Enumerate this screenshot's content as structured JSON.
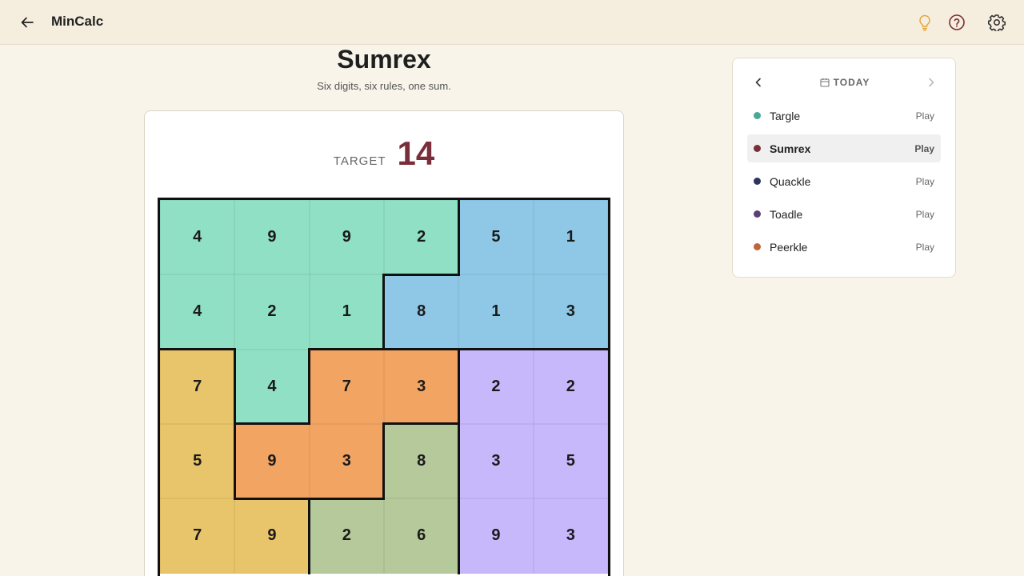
{
  "app": {
    "title": "MinCalc"
  },
  "header": {
    "back_icon": "arrow-left-icon",
    "hint_icon": "lightbulb-icon",
    "help_icon": "question-circle-icon",
    "settings_icon": "gear-icon"
  },
  "game": {
    "title": "Sumrex",
    "subtitle": "Six digits, six rules, one sum.",
    "target_label": "TARGET",
    "target_value": "14"
  },
  "colors": {
    "accent": "#7a2e3a",
    "region_teal": "#8fe0c4",
    "region_blue": "#8fc8e6",
    "region_yellow": "#e8c46a",
    "region_orange": "#f2a462",
    "region_olive": "#b5c99a",
    "region_purple": "#c7b8fb"
  },
  "grid": {
    "rows": [
      [
        {
          "v": "4",
          "r": "teal"
        },
        {
          "v": "9",
          "r": "teal"
        },
        {
          "v": "9",
          "r": "teal"
        },
        {
          "v": "2",
          "r": "teal"
        },
        {
          "v": "5",
          "r": "blue"
        },
        {
          "v": "1",
          "r": "blue"
        }
      ],
      [
        {
          "v": "4",
          "r": "teal"
        },
        {
          "v": "2",
          "r": "teal"
        },
        {
          "v": "1",
          "r": "teal"
        },
        {
          "v": "8",
          "r": "blue"
        },
        {
          "v": "1",
          "r": "blue"
        },
        {
          "v": "3",
          "r": "blue"
        }
      ],
      [
        {
          "v": "7",
          "r": "yellow"
        },
        {
          "v": "4",
          "r": "teal"
        },
        {
          "v": "7",
          "r": "orange"
        },
        {
          "v": "3",
          "r": "orange"
        },
        {
          "v": "2",
          "r": "purple"
        },
        {
          "v": "2",
          "r": "purple"
        }
      ],
      [
        {
          "v": "5",
          "r": "yellow"
        },
        {
          "v": "9",
          "r": "orange"
        },
        {
          "v": "3",
          "r": "orange"
        },
        {
          "v": "8",
          "r": "olive"
        },
        {
          "v": "3",
          "r": "purple"
        },
        {
          "v": "5",
          "r": "purple"
        }
      ],
      [
        {
          "v": "7",
          "r": "yellow"
        },
        {
          "v": "9",
          "r": "yellow"
        },
        {
          "v": "2",
          "r": "olive"
        },
        {
          "v": "6",
          "r": "olive"
        },
        {
          "v": "9",
          "r": "purple"
        },
        {
          "v": "3",
          "r": "purple"
        }
      ]
    ]
  },
  "sidebar": {
    "date_label": "TODAY",
    "calendar_icon": "calendar-icon",
    "prev_icon": "chevron-left-icon",
    "next_icon": "chevron-right-icon",
    "games": [
      {
        "name": "Targle",
        "action": "Play",
        "color": "#4aa894",
        "active": false
      },
      {
        "name": "Sumrex",
        "action": "Play",
        "color": "#7a2e3a",
        "active": true
      },
      {
        "name": "Quackle",
        "action": "Play",
        "color": "#2c3560",
        "active": false
      },
      {
        "name": "Toadle",
        "action": "Play",
        "color": "#5c3f78",
        "active": false
      },
      {
        "name": "Peerkle",
        "action": "Play",
        "color": "#c0643a",
        "active": false
      }
    ]
  }
}
